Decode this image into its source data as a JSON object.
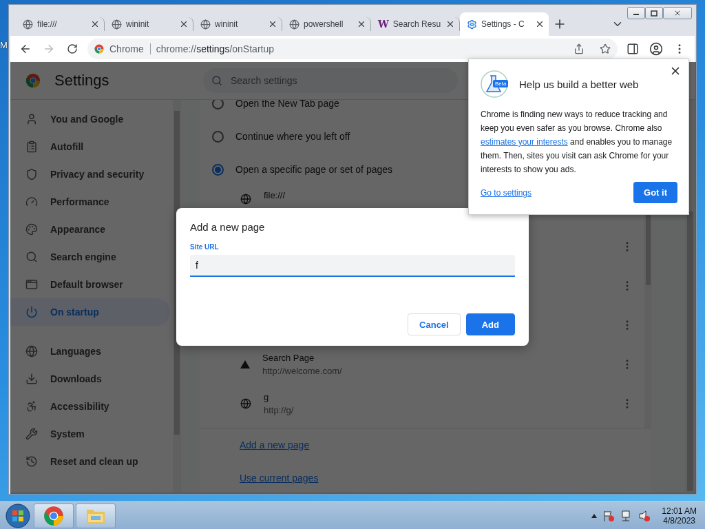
{
  "desktop": {
    "label": "M"
  },
  "tabs": [
    {
      "title": "file:///",
      "kind": "site",
      "selected": false
    },
    {
      "title": "wininit",
      "kind": "site",
      "selected": false
    },
    {
      "title": "wininit",
      "kind": "site",
      "selected": false
    },
    {
      "title": "powershell",
      "kind": "site",
      "selected": false
    },
    {
      "title": "Search Resu",
      "kind": "lettered",
      "logo": "W",
      "selected": false
    },
    {
      "title": "Settings - C",
      "kind": "settings",
      "selected": true
    }
  ],
  "toolbar": {
    "back_enabled": true,
    "forward_enabled": false,
    "chip": "Chrome",
    "url": {
      "scheme": "chrome://",
      "host": "settings",
      "path": "/onStartup"
    }
  },
  "settings": {
    "title": "Settings",
    "search_placeholder": "Search settings",
    "nav": [
      {
        "items": [
          {
            "label": "You and Google",
            "selected": false
          },
          {
            "label": "Autofill",
            "selected": false
          },
          {
            "label": "Privacy and security",
            "selected": false
          },
          {
            "label": "Performance",
            "selected": false
          },
          {
            "label": "Appearance",
            "selected": false
          },
          {
            "label": "Search engine",
            "selected": false
          },
          {
            "label": "Default browser",
            "selected": false
          },
          {
            "label": "On startup",
            "selected": true
          }
        ]
      },
      {
        "items": [
          {
            "label": "Languages",
            "selected": false
          },
          {
            "label": "Downloads",
            "selected": false
          },
          {
            "label": "Accessibility",
            "selected": false
          },
          {
            "label": "System",
            "selected": false
          },
          {
            "label": "Reset and clean up",
            "selected": false
          }
        ]
      }
    ],
    "startup_options": [
      {
        "label": "Open the New Tab page",
        "selected": false
      },
      {
        "label": "Continue where you left off",
        "selected": false
      },
      {
        "label": "Open a specific page or set of pages",
        "selected": true
      }
    ],
    "pages": [
      {
        "kind": "partial",
        "title": "file:///"
      },
      {
        "kind": "covered"
      },
      {
        "kind": "covered"
      },
      {
        "kind": "covered"
      },
      {
        "kind": "marked",
        "title": "Search Page",
        "url": "http://welcome.com/"
      },
      {
        "kind": "page",
        "title": "g",
        "url": "http://g/"
      }
    ],
    "links": [
      "Add a new page",
      "Use current pages"
    ]
  },
  "dialog": {
    "title": "Add a new page",
    "field_label": "Site URL",
    "value": "f",
    "buttons": [
      {
        "label": "Cancel",
        "kind": "secondary"
      },
      {
        "label": "Add",
        "kind": "primary"
      }
    ]
  },
  "bubble": {
    "badge": "Beta",
    "title": "Help us build a better web",
    "body_before": "Chrome is finding new ways to reduce tracking and keep you even safer as you browse. Chrome also ",
    "body_link": "estimates your interests",
    "body_after": " and enables you to manage them. Then, sites you visit can ask Chrome for your interests to show you ads.",
    "link": "Go to settings",
    "button": "Got it"
  },
  "taskbar": {
    "apps": [
      {
        "kind": "chrome"
      },
      {
        "kind": "explorer"
      }
    ],
    "time": "12:01 AM",
    "date": "4/8/2023"
  }
}
